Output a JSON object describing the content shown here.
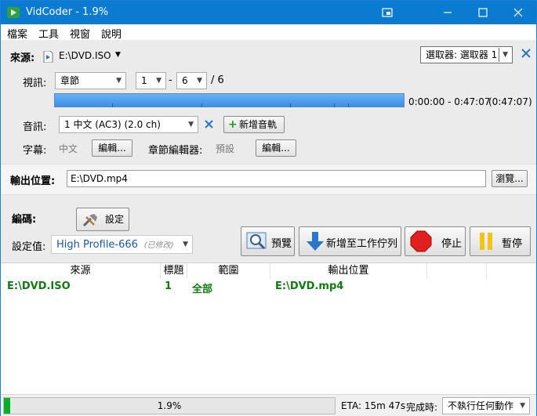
{
  "window": {
    "title": "VidCoder - 1.9%",
    "controls": [
      "restore-window-icon",
      "minimize-icon",
      "maximize-icon",
      "close-icon"
    ]
  },
  "menu": [
    "檔案",
    "工具",
    "視窗",
    "說明"
  ],
  "source": {
    "label": "來源:",
    "value": "E:\\DVD.ISO",
    "picker": "選取器: 選取器 1"
  },
  "video": {
    "label": "視訊:",
    "mode": "章節",
    "start": "1",
    "dash": "-",
    "end": "6",
    "total": "/ 6",
    "time_range": "0:00:00 - 0:47:07",
    "duration": "(0:47:07)",
    "progress_fraction": 1.0
  },
  "audio": {
    "label": "音訊:",
    "track": "1 中文 (AC3) (2.0 ch)",
    "add_label": "新增音軌"
  },
  "subtitles": {
    "label": "字幕:",
    "value": "中文",
    "edit_label": "編輯...",
    "chapter_label": "章節編輯器:",
    "chapter_value": "預設",
    "chapter_edit_label": "編輯..."
  },
  "output": {
    "label": "輸出位置:",
    "path": "E:\\DVD.mp4",
    "browse_label": "瀏覽..."
  },
  "encoding": {
    "label": "編碼:",
    "settings_label": "設定",
    "preset_label": "設定值:",
    "preset_name": "High Profile-666",
    "preset_modified": "(已修改)",
    "preview_label": "預覽",
    "add_queue_label": "新增至工作佇列",
    "stop_label": "停止",
    "pause_label": "暫停"
  },
  "queue": {
    "headers": [
      "來源",
      "標題",
      "範圍",
      "輸出位置"
    ],
    "rows": [
      {
        "source": "E:\\DVD.ISO",
        "title": "1",
        "range": "全部",
        "output": "E:\\DVD.mp4"
      }
    ]
  },
  "status": {
    "progress_percent": 1.9,
    "progress_text": "1.9%",
    "eta": "ETA: 15m 47s",
    "when_done_label": "完成時:",
    "when_done_value": "不執行任何動作"
  },
  "colors": {
    "titlebar": "#0a7bd1",
    "progress_fill": "#06b025",
    "queue_text": "#117a11",
    "preset_text": "#1a56a8"
  }
}
